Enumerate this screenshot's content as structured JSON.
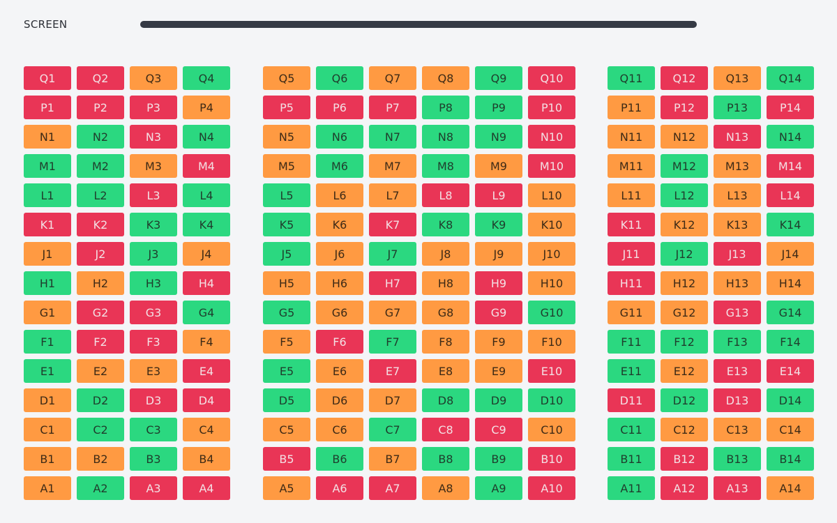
{
  "screen": {
    "label": "SCREEN"
  },
  "colors": {
    "available": "#2bd880",
    "reserved": "#ff9a42",
    "sold": "#e93556",
    "screen_bar": "#353a45"
  },
  "seating": {
    "rows": [
      "Q",
      "P",
      "N",
      "M",
      "L",
      "K",
      "J",
      "H",
      "G",
      "F",
      "E",
      "D",
      "C",
      "B",
      "A"
    ],
    "blocks": [
      {
        "name": "left",
        "first_seat": 1,
        "seat_count": 4,
        "status": [
          [
            "sold",
            "sold",
            "reserved",
            "available"
          ],
          [
            "sold",
            "sold",
            "sold",
            "reserved"
          ],
          [
            "reserved",
            "available",
            "sold",
            "available"
          ],
          [
            "available",
            "available",
            "reserved",
            "sold"
          ],
          [
            "available",
            "available",
            "sold",
            "available"
          ],
          [
            "sold",
            "sold",
            "available",
            "available"
          ],
          [
            "reserved",
            "sold",
            "available",
            "reserved"
          ],
          [
            "available",
            "reserved",
            "available",
            "sold"
          ],
          [
            "reserved",
            "sold",
            "sold",
            "available"
          ],
          [
            "available",
            "sold",
            "sold",
            "reserved"
          ],
          [
            "available",
            "reserved",
            "reserved",
            "sold"
          ],
          [
            "reserved",
            "available",
            "sold",
            "sold"
          ],
          [
            "reserved",
            "available",
            "available",
            "reserved"
          ],
          [
            "reserved",
            "reserved",
            "available",
            "reserved"
          ],
          [
            "reserved",
            "available",
            "sold",
            "sold"
          ]
        ]
      },
      {
        "name": "center",
        "first_seat": 5,
        "seat_count": 6,
        "status": [
          [
            "reserved",
            "available",
            "reserved",
            "reserved",
            "available",
            "sold"
          ],
          [
            "sold",
            "sold",
            "sold",
            "available",
            "available",
            "sold"
          ],
          [
            "reserved",
            "available",
            "available",
            "available",
            "available",
            "sold"
          ],
          [
            "reserved",
            "available",
            "reserved",
            "available",
            "reserved",
            "sold"
          ],
          [
            "available",
            "reserved",
            "reserved",
            "sold",
            "sold",
            "reserved"
          ],
          [
            "available",
            "reserved",
            "sold",
            "available",
            "available",
            "reserved"
          ],
          [
            "available",
            "reserved",
            "available",
            "reserved",
            "reserved",
            "reserved"
          ],
          [
            "reserved",
            "reserved",
            "sold",
            "reserved",
            "sold",
            "reserved"
          ],
          [
            "available",
            "reserved",
            "reserved",
            "reserved",
            "sold",
            "available"
          ],
          [
            "reserved",
            "sold",
            "available",
            "reserved",
            "reserved",
            "reserved"
          ],
          [
            "available",
            "reserved",
            "sold",
            "reserved",
            "reserved",
            "sold"
          ],
          [
            "available",
            "reserved",
            "reserved",
            "available",
            "available",
            "available"
          ],
          [
            "reserved",
            "reserved",
            "available",
            "sold",
            "sold",
            "reserved"
          ],
          [
            "sold",
            "available",
            "reserved",
            "available",
            "available",
            "sold"
          ],
          [
            "reserved",
            "sold",
            "sold",
            "reserved",
            "available",
            "sold"
          ]
        ]
      },
      {
        "name": "right",
        "first_seat": 11,
        "seat_count": 4,
        "status": [
          [
            "available",
            "sold",
            "reserved",
            "available"
          ],
          [
            "reserved",
            "sold",
            "available",
            "sold"
          ],
          [
            "reserved",
            "reserved",
            "sold",
            "available"
          ],
          [
            "reserved",
            "available",
            "reserved",
            "sold"
          ],
          [
            "reserved",
            "available",
            "reserved",
            "sold"
          ],
          [
            "sold",
            "reserved",
            "reserved",
            "available"
          ],
          [
            "sold",
            "available",
            "sold",
            "reserved"
          ],
          [
            "sold",
            "reserved",
            "reserved",
            "reserved"
          ],
          [
            "reserved",
            "reserved",
            "sold",
            "available"
          ],
          [
            "available",
            "available",
            "available",
            "available"
          ],
          [
            "available",
            "reserved",
            "sold",
            "sold"
          ],
          [
            "sold",
            "available",
            "sold",
            "available"
          ],
          [
            "available",
            "reserved",
            "reserved",
            "reserved"
          ],
          [
            "available",
            "sold",
            "available",
            "available"
          ],
          [
            "available",
            "sold",
            "sold",
            "reserved"
          ]
        ]
      }
    ]
  }
}
